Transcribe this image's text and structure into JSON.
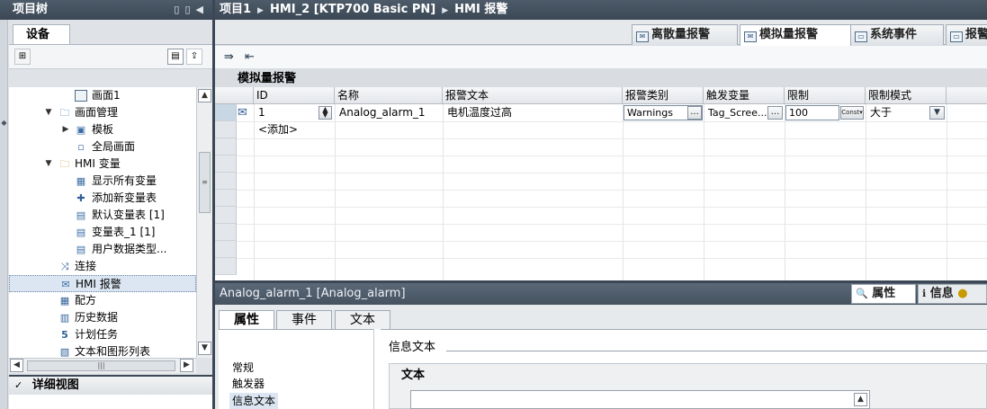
{
  "project_tree": {
    "title": "项目树",
    "device_tab": "设备",
    "items": [
      {
        "label": "画面1",
        "icon": "screen-icon"
      },
      {
        "label": "画面管理",
        "icon": "folder-icon"
      },
      {
        "label": "模板",
        "icon": "template-icon"
      },
      {
        "label": "全局画面",
        "icon": "global-screen-icon"
      },
      {
        "label": "HMI 变量",
        "icon": "folder-icon"
      },
      {
        "label": "显示所有变量",
        "icon": "variables-icon"
      },
      {
        "label": "添加新变量表",
        "icon": "add-table-icon"
      },
      {
        "label": "默认变量表 [1]",
        "icon": "table-icon"
      },
      {
        "label": "变量表_1 [1]",
        "icon": "table-icon"
      },
      {
        "label": "用户数据类型...",
        "icon": "table-icon"
      },
      {
        "label": "连接",
        "icon": "connection-icon"
      },
      {
        "label": "HMI 报警",
        "icon": "alarm-icon"
      },
      {
        "label": "配方",
        "icon": "recipe-icon"
      },
      {
        "label": "历史数据",
        "icon": "history-icon"
      },
      {
        "label": "计划任务",
        "icon": "task-icon"
      },
      {
        "label": "文本和图形列表",
        "icon": "list-icon"
      }
    ],
    "detail_view": "详细视图"
  },
  "breadcrumb": [
    "项目1",
    "HMI_2 [KTP700 Basic PN]",
    "HMI 报警"
  ],
  "editor_tabs": [
    {
      "label": "离散量报警",
      "active": false
    },
    {
      "label": "模拟量报警",
      "active": true
    },
    {
      "label": "系统事件",
      "active": false
    },
    {
      "label": "报警",
      "active": false
    }
  ],
  "grid": {
    "title": "模拟量报警",
    "columns": [
      "ID",
      "名称",
      "报警文本",
      "报警类别",
      "触发变量",
      "限制",
      "限制模式"
    ],
    "rows": [
      {
        "id": "1",
        "name": "Analog_alarm_1",
        "text": "电机温度过高",
        "class": "Warnings",
        "tag": "Tag_Scree...",
        "limit": "100",
        "limit_type": "Const",
        "mode": "大于"
      }
    ],
    "add_row": "<添加>",
    "ellipsis": "..."
  },
  "inspector": {
    "title": "Analog_alarm_1 [Analog_alarm]",
    "tabs": [
      "属性",
      "信息"
    ],
    "prop_tabs": [
      "属性",
      "事件",
      "文本"
    ],
    "nav": [
      "常规",
      "触发器",
      "信息文本"
    ],
    "section": "信息文本",
    "group": "文本"
  },
  "colors": {
    "title_bar": "#3b4754",
    "accent": "#dbe6f2"
  }
}
